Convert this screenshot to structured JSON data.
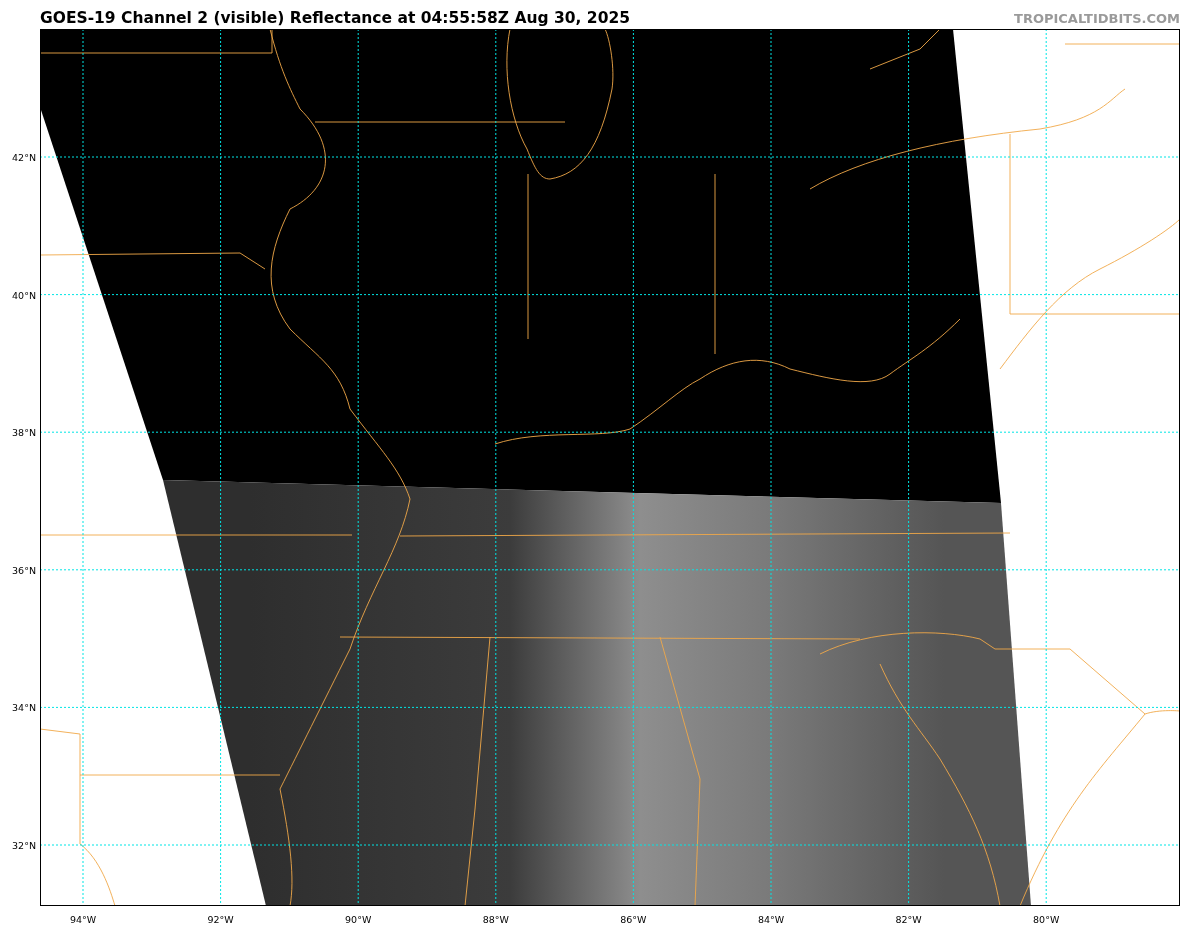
{
  "title": "GOES-19 Channel 2 (visible) Reflectance at 04:55:58Z Aug 30, 2025",
  "credit": "TROPICALTIDBITS.COM",
  "latitude_labels": [
    "42°N",
    "40°N",
    "38°N",
    "36°N",
    "34°N",
    "32°N"
  ],
  "longitude_labels": [
    "94°W",
    "92°W",
    "90°W",
    "88°W",
    "86°W",
    "84°W",
    "82°W",
    "80°W"
  ]
}
